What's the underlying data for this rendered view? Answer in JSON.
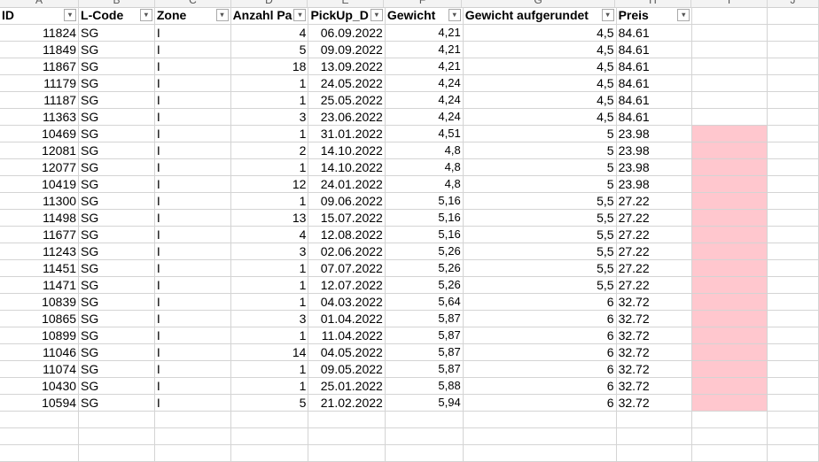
{
  "column_letters": [
    "A",
    "B",
    "C",
    "D",
    "E",
    "F",
    "G",
    "H",
    "I",
    "J"
  ],
  "headers": [
    {
      "label": "ID"
    },
    {
      "label": "L-Code"
    },
    {
      "label": "Zone"
    },
    {
      "label": "Anzahl Pa"
    },
    {
      "label": "PickUp_D"
    },
    {
      "label": "Gewicht"
    },
    {
      "label": "Gewicht aufgerundet"
    },
    {
      "label": "Preis"
    }
  ],
  "filter_icon": "dropdown-arrow-icon",
  "highlight_color": "#ffc7ce",
  "rows": [
    {
      "id": "11824",
      "lcode": "SG",
      "zone": "I",
      "anzahl": "4",
      "pickup": "06.09.2022",
      "gewicht": "4,21",
      "aufgerundet": "4,5",
      "preis": "84.61",
      "highlight": false
    },
    {
      "id": "11849",
      "lcode": "SG",
      "zone": "I",
      "anzahl": "5",
      "pickup": "09.09.2022",
      "gewicht": "4,21",
      "aufgerundet": "4,5",
      "preis": "84.61",
      "highlight": false
    },
    {
      "id": "11867",
      "lcode": "SG",
      "zone": "I",
      "anzahl": "18",
      "pickup": "13.09.2022",
      "gewicht": "4,21",
      "aufgerundet": "4,5",
      "preis": "84.61",
      "highlight": false
    },
    {
      "id": "11179",
      "lcode": "SG",
      "zone": "I",
      "anzahl": "1",
      "pickup": "24.05.2022",
      "gewicht": "4,24",
      "aufgerundet": "4,5",
      "preis": "84.61",
      "highlight": false
    },
    {
      "id": "11187",
      "lcode": "SG",
      "zone": "I",
      "anzahl": "1",
      "pickup": "25.05.2022",
      "gewicht": "4,24",
      "aufgerundet": "4,5",
      "preis": "84.61",
      "highlight": false
    },
    {
      "id": "11363",
      "lcode": "SG",
      "zone": "I",
      "anzahl": "3",
      "pickup": "23.06.2022",
      "gewicht": "4,24",
      "aufgerundet": "4,5",
      "preis": "84.61",
      "highlight": false
    },
    {
      "id": "10469",
      "lcode": "SG",
      "zone": "I",
      "anzahl": "1",
      "pickup": "31.01.2022",
      "gewicht": "4,51",
      "aufgerundet": "5",
      "preis": "23.98",
      "highlight": true
    },
    {
      "id": "12081",
      "lcode": "SG",
      "zone": "I",
      "anzahl": "2",
      "pickup": "14.10.2022",
      "gewicht": "4,8",
      "aufgerundet": "5",
      "preis": "23.98",
      "highlight": true
    },
    {
      "id": "12077",
      "lcode": "SG",
      "zone": "I",
      "anzahl": "1",
      "pickup": "14.10.2022",
      "gewicht": "4,8",
      "aufgerundet": "5",
      "preis": "23.98",
      "highlight": true
    },
    {
      "id": "10419",
      "lcode": "SG",
      "zone": "I",
      "anzahl": "12",
      "pickup": "24.01.2022",
      "gewicht": "4,8",
      "aufgerundet": "5",
      "preis": "23.98",
      "highlight": true
    },
    {
      "id": "11300",
      "lcode": "SG",
      "zone": "I",
      "anzahl": "1",
      "pickup": "09.06.2022",
      "gewicht": "5,16",
      "aufgerundet": "5,5",
      "preis": "27.22",
      "highlight": true
    },
    {
      "id": "11498",
      "lcode": "SG",
      "zone": "I",
      "anzahl": "13",
      "pickup": "15.07.2022",
      "gewicht": "5,16",
      "aufgerundet": "5,5",
      "preis": "27.22",
      "highlight": true
    },
    {
      "id": "11677",
      "lcode": "SG",
      "zone": "I",
      "anzahl": "4",
      "pickup": "12.08.2022",
      "gewicht": "5,16",
      "aufgerundet": "5,5",
      "preis": "27.22",
      "highlight": true
    },
    {
      "id": "11243",
      "lcode": "SG",
      "zone": "I",
      "anzahl": "3",
      "pickup": "02.06.2022",
      "gewicht": "5,26",
      "aufgerundet": "5,5",
      "preis": "27.22",
      "highlight": true
    },
    {
      "id": "11451",
      "lcode": "SG",
      "zone": "I",
      "anzahl": "1",
      "pickup": "07.07.2022",
      "gewicht": "5,26",
      "aufgerundet": "5,5",
      "preis": "27.22",
      "highlight": true
    },
    {
      "id": "11471",
      "lcode": "SG",
      "zone": "I",
      "anzahl": "1",
      "pickup": "12.07.2022",
      "gewicht": "5,26",
      "aufgerundet": "5,5",
      "preis": "27.22",
      "highlight": true
    },
    {
      "id": "10839",
      "lcode": "SG",
      "zone": "I",
      "anzahl": "1",
      "pickup": "04.03.2022",
      "gewicht": "5,64",
      "aufgerundet": "6",
      "preis": "32.72",
      "highlight": true
    },
    {
      "id": "10865",
      "lcode": "SG",
      "zone": "I",
      "anzahl": "3",
      "pickup": "01.04.2022",
      "gewicht": "5,87",
      "aufgerundet": "6",
      "preis": "32.72",
      "highlight": true
    },
    {
      "id": "10899",
      "lcode": "SG",
      "zone": "I",
      "anzahl": "1",
      "pickup": "11.04.2022",
      "gewicht": "5,87",
      "aufgerundet": "6",
      "preis": "32.72",
      "highlight": true
    },
    {
      "id": "11046",
      "lcode": "SG",
      "zone": "I",
      "anzahl": "14",
      "pickup": "04.05.2022",
      "gewicht": "5,87",
      "aufgerundet": "6",
      "preis": "32.72",
      "highlight": true
    },
    {
      "id": "11074",
      "lcode": "SG",
      "zone": "I",
      "anzahl": "1",
      "pickup": "09.05.2022",
      "gewicht": "5,87",
      "aufgerundet": "6",
      "preis": "32.72",
      "highlight": true
    },
    {
      "id": "10430",
      "lcode": "SG",
      "zone": "I",
      "anzahl": "1",
      "pickup": "25.01.2022",
      "gewicht": "5,88",
      "aufgerundet": "6",
      "preis": "32.72",
      "highlight": true
    },
    {
      "id": "10594",
      "lcode": "SG",
      "zone": "I",
      "anzahl": "5",
      "pickup": "21.02.2022",
      "gewicht": "5,94",
      "aufgerundet": "6",
      "preis": "32.72",
      "highlight": true
    }
  ]
}
